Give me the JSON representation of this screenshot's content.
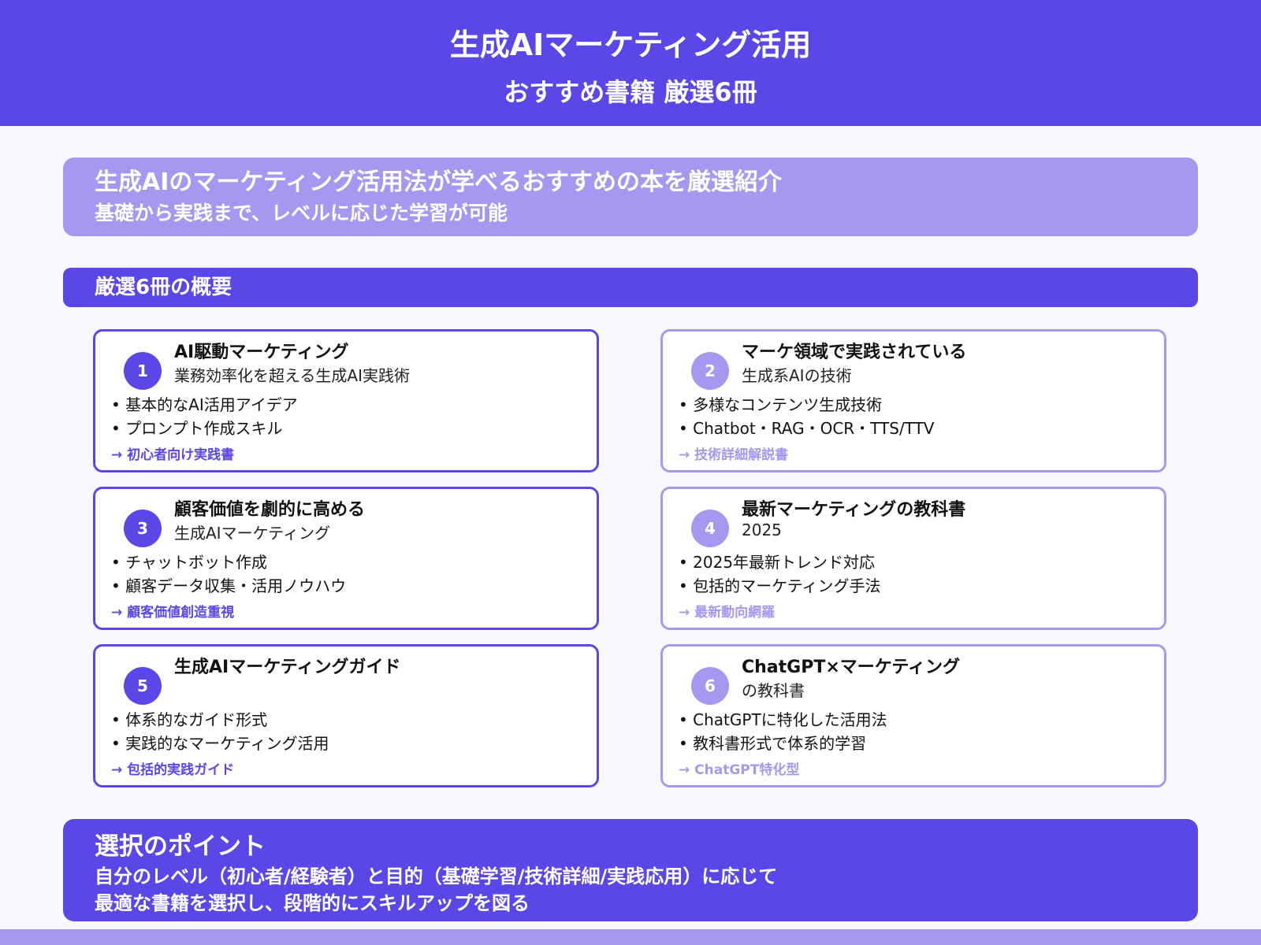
{
  "header": {
    "title": "生成AIマーケティング活用",
    "subtitle": "おすすめ書籍 厳選6冊"
  },
  "intro": {
    "line1": "生成AIのマーケティング活用法が学べるおすすめの本を厳選紹介",
    "line2": "基礎から実践まで、レベルに応じた学習が可能"
  },
  "section": {
    "title": "厳選6冊の概要"
  },
  "books": [
    {
      "num": "1",
      "title": "AI駆動マーケティング",
      "subtitle": "業務効率化を超える生成AI実践術",
      "bullets": [
        "基本的なAI活用アイデア",
        "プロンプト作成スキル"
      ],
      "tag": "→ 初心者向け実践書"
    },
    {
      "num": "2",
      "title": "マーケ領域で実践されている",
      "subtitle": "生成系AIの技術",
      "bullets": [
        "多様なコンテンツ生成技術",
        "Chatbot・RAG・OCR・TTS/TTV"
      ],
      "tag": "→ 技術詳細解説書"
    },
    {
      "num": "3",
      "title": "顧客価値を劇的に高める",
      "subtitle": "生成AIマーケティング",
      "bullets": [
        "チャットボット作成",
        "顧客データ収集・活用ノウハウ"
      ],
      "tag": "→ 顧客価値創造重視"
    },
    {
      "num": "4",
      "title": "最新マーケティングの教科書",
      "subtitle": "2025",
      "bullets": [
        "2025年最新トレンド対応",
        "包括的マーケティング手法"
      ],
      "tag": "→ 最新動向網羅"
    },
    {
      "num": "5",
      "title": "生成AIマーケティングガイド",
      "subtitle": "",
      "bullets": [
        "体系的なガイド形式",
        "実践的なマーケティング活用"
      ],
      "tag": "→ 包括的実践ガイド"
    },
    {
      "num": "6",
      "title": "ChatGPT×マーケティング",
      "subtitle": "の教科書",
      "bullets": [
        "ChatGPTに特化した活用法",
        "教科書形式で体系的学習"
      ],
      "tag": "→ ChatGPT特化型"
    }
  ],
  "points": {
    "title": "選択のポイント",
    "line1": "自分のレベル（初心者/経験者）と目的（基礎学習/技術詳細/実践応用）に応じて",
    "line2": "最適な書籍を選択し、段階的にスキルアップを図る"
  },
  "colors": {
    "primary": "#5b46e8",
    "secondary": "#a498f0",
    "background": "#f7f7fd"
  }
}
